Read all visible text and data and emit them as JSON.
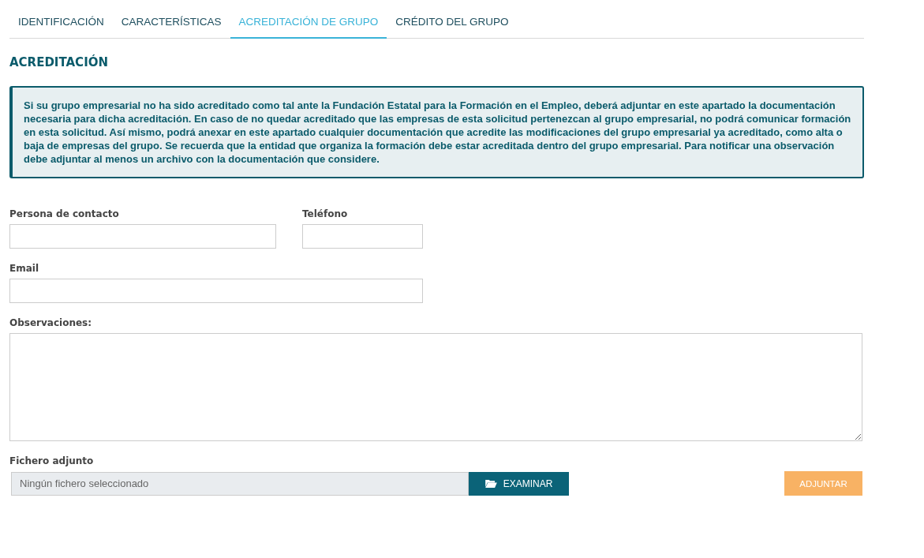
{
  "tabs": [
    {
      "label": "IDENTIFICACIÓN",
      "selected": false
    },
    {
      "label": "CARACTERÍSTICAS",
      "selected": false
    },
    {
      "label": "ACREDITACIÓN DE GRUPO",
      "selected": true
    },
    {
      "label": "CRÉDITO DEL GRUPO",
      "selected": false
    }
  ],
  "section_title": "ACREDITACIÓN",
  "info_text": "Si su grupo empresarial no ha sido acreditado como tal ante la Fundación Estatal para la Formación en el Empleo, deberá adjuntar en este apartado la documentación necesaria para dicha acreditación. En caso de no quedar acreditado que las empresas de esta solicitud pertenezcan al grupo empresarial, no podrá comunicar formación en esta solicitud. Así mismo, podrá anexar en este apartado cualquier documentación que acredite las modificaciones del grupo empresarial ya acreditado, como alta o baja de empresas del grupo. Se recuerda que la entidad que organiza la formación debe estar acreditada dentro del grupo empresarial. Para notificar una observación debe adjuntar al menos un archivo con la documentación que considere.",
  "form": {
    "contact_label": "Persona de contacto",
    "phone_label": "Teléfono",
    "email_label": "Email",
    "notes_label": "Observaciones:",
    "file_label": "Fichero adjunto",
    "file_placeholder": "Ningún fichero seleccionado",
    "browse_button": "EXAMINAR",
    "attach_button": {
      "label": "ADJUNTAR",
      "disabled": true
    }
  }
}
